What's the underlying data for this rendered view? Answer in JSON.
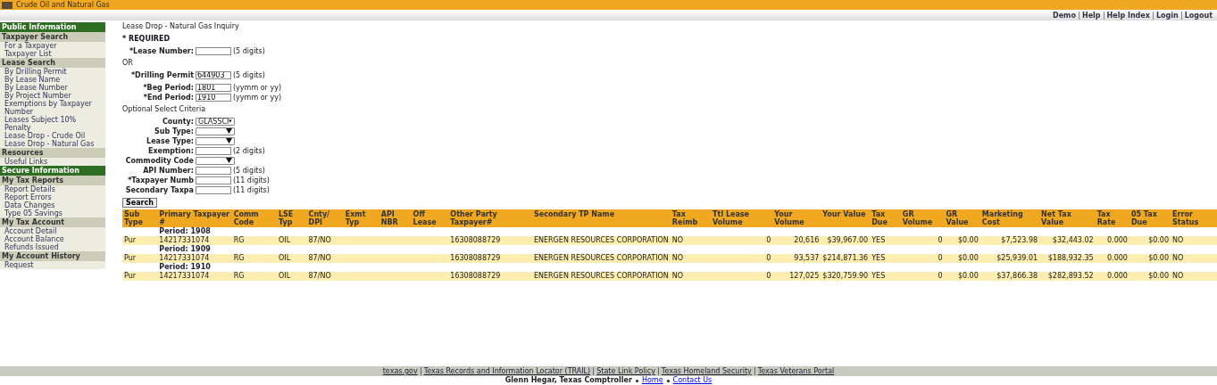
{
  "header": {
    "title": "Crude Oil and Natural Gas"
  },
  "top_links": [
    "Demo",
    "Help",
    "Help Index",
    "Login",
    "Logout"
  ],
  "sidebar": [
    {
      "label": "Public Information",
      "groups": [
        {
          "label": "Taxpayer Search",
          "items": [
            "For a Taxpayer",
            "Taxpayer List"
          ]
        },
        {
          "label": "Lease Search",
          "items": [
            "By Drilling Permit",
            "By Lease Name",
            "By Lease Number",
            "By Project Number",
            "Exemptions by Taxpayer Number",
            "Leases Subject 10% Penalty",
            "Lease Drop - Crude Oil",
            "Lease Drop - Natural Gas"
          ]
        },
        {
          "label": "Resources",
          "items": [
            "Useful Links"
          ]
        }
      ]
    },
    {
      "label": "Secure Information",
      "groups": [
        {
          "label": "My Tax Reports",
          "items": [
            "Report Details",
            "Report Errors",
            "Data Changes",
            "Type 05 Savings"
          ]
        },
        {
          "label": "My Tax Account",
          "items": [
            "Account Detail",
            "Account Balance",
            "Refunds Issued"
          ]
        },
        {
          "label": "My Account History",
          "items": [
            "Request"
          ]
        }
      ]
    }
  ],
  "page_title": "Lease Drop - Natural Gas Inquiry",
  "form_sections": [
    [
      {
        "kind": "heading",
        "text": "* REQUIRED"
      }
    ],
    [
      {
        "kind": "input",
        "label": "*Lease Number:",
        "hint": "(5 digits)"
      }
    ],
    [
      {
        "kind": "text",
        "text": "OR"
      }
    ],
    [
      {
        "kind": "input",
        "label": "*Drilling Permit",
        "value": "644903",
        "hint": "(5 digits)"
      }
    ],
    [
      {
        "kind": "input",
        "label": "*Beg Period:",
        "value": "1801",
        "hint": "(yymm or yy)"
      },
      {
        "kind": "input",
        "label": "*End Period:",
        "value": "1910",
        "hint": "(yymm or yy)"
      }
    ],
    [
      {
        "kind": "text",
        "text": "Optional Select Criteria"
      }
    ],
    [
      {
        "kind": "select",
        "label": "County:",
        "value": "GLASSCI"
      },
      {
        "kind": "select",
        "label": "Sub Type:"
      },
      {
        "kind": "select",
        "label": "Lease Type:"
      },
      {
        "kind": "input",
        "label": "Exemption:",
        "hint": "(2 digits)"
      },
      {
        "kind": "select",
        "label": "Commodity Code"
      },
      {
        "kind": "input",
        "label": "API Number:",
        "hint": "(5 digits)"
      },
      {
        "kind": "input",
        "label": "*Taxpayer Numb",
        "hint": "(11 digits)"
      },
      {
        "kind": "input",
        "label": "Secondary Taxpa",
        "hint": "(11 digits)"
      }
    ],
    [
      {
        "kind": "button",
        "text": "Search"
      }
    ]
  ],
  "table": {
    "columns": [
      "Sub Type",
      "Primary Taxpayer #",
      "Comm Code",
      "LSE Typ",
      "Cnty/ DPI",
      "Exmt Typ",
      "API NBR",
      "Off Lease",
      "Other Party Taxpayer#",
      "Secondary TP Name",
      "Tax Reimb",
      "Ttl Lease Volume",
      "Your Volume",
      "Your Value",
      "Tax Due",
      "GR Volume",
      "GR Value",
      "Marketing Cost",
      "Net Tax Value",
      "Tax Rate",
      "05 Tax Due",
      "Error Status"
    ],
    "rows": [
      {
        "kind": "period",
        "text": "Period: 1908"
      },
      {
        "kind": "data",
        "cells": [
          "Pur",
          "14217331074",
          "RG",
          "OIL",
          "87/NO",
          null,
          null,
          null,
          "16308088729",
          "ENERGEN RESOURCES CORPORATION",
          "NO",
          "0",
          "20,616",
          "$39,967.00",
          "YES",
          "0",
          "$0.00",
          "$7,523.98",
          "$32,443.02",
          "0.000",
          "$0.00",
          "NO"
        ]
      },
      {
        "kind": "period",
        "text": "Period: 1909"
      },
      {
        "kind": "data",
        "cells": [
          "Pur",
          "14217331074",
          "RG",
          "OIL",
          "87/NO",
          null,
          null,
          null,
          "16308088729",
          "ENERGEN RESOURCES CORPORATION",
          "NO",
          "0",
          "93,537",
          "$214,871.36",
          "YES",
          "0",
          "$0.00",
          "$25,939.01",
          "$188,932.35",
          "0.000",
          "$0.00",
          "NO"
        ]
      },
      {
        "kind": "period",
        "text": "Period: 1910"
      },
      {
        "kind": "data",
        "cells": [
          "Pur",
          "14217331074",
          "RG",
          "OIL",
          "87/NO",
          null,
          null,
          null,
          "16308088729",
          "ENERGEN RESOURCES CORPORATION",
          "NO",
          "0",
          "127,025",
          "$320,759.90",
          "YES",
          "0",
          "$0.00",
          "$37,866.38",
          "$282,893.52",
          "0.000",
          "$0.00",
          "NO"
        ]
      }
    ]
  },
  "footer_links": [
    "texas.gov",
    "Texas Records and Information Locator (TRAIL)",
    "State Link Policy",
    "Texas Homeland Security",
    "Texas Veterans Portal"
  ],
  "footer_credit": [
    "Glenn Hegar, Texas Comptroller",
    "Home",
    "Contact Us"
  ]
}
